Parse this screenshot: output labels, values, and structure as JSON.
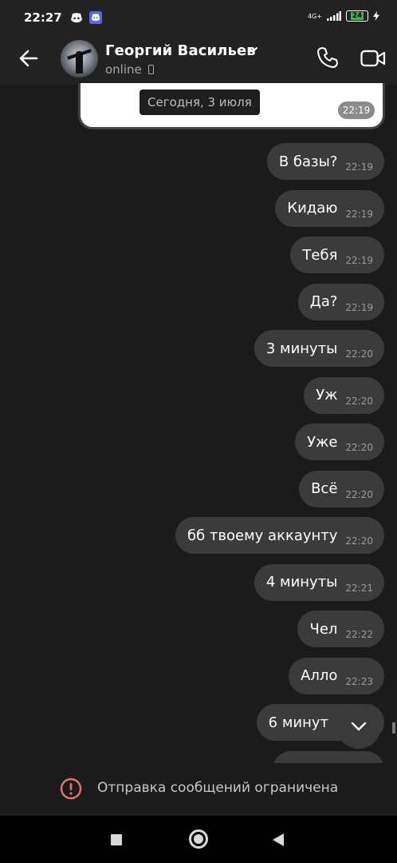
{
  "status_bar": {
    "time": "22:27",
    "network": "4G+",
    "battery": "24"
  },
  "header": {
    "contact_name": "Георгий Васильев",
    "contact_status": "online"
  },
  "pinned": {
    "date_label": "Сегодня, 3 июля",
    "time": "22:19"
  },
  "messages": [
    {
      "text": "В базы?",
      "time": "22:19"
    },
    {
      "text": "Кидаю",
      "time": "22:19"
    },
    {
      "text": "Тебя",
      "time": "22:19"
    },
    {
      "text": "Да?",
      "time": "22:19"
    },
    {
      "text": "3 минуты",
      "time": "22:20"
    },
    {
      "text": "Уж",
      "time": "22:20"
    },
    {
      "text": "Уже",
      "time": "22:20"
    },
    {
      "text": "Всё",
      "time": "22:20"
    },
    {
      "text": "бб твоему аккаунту",
      "time": "22:20"
    },
    {
      "text": "4 минуты",
      "time": "22:21"
    },
    {
      "text": "Чел",
      "time": "22:22"
    },
    {
      "text": "Алло",
      "time": "22:23"
    },
    {
      "text": "6 минут",
      "time": ""
    }
  ],
  "restricted_notice": "Отправка сообщений ограничена",
  "colors": {
    "bubble": "#3b3b3b",
    "background": "#1b1b1b",
    "warning": "#e57373",
    "battery": "#4caf50"
  }
}
